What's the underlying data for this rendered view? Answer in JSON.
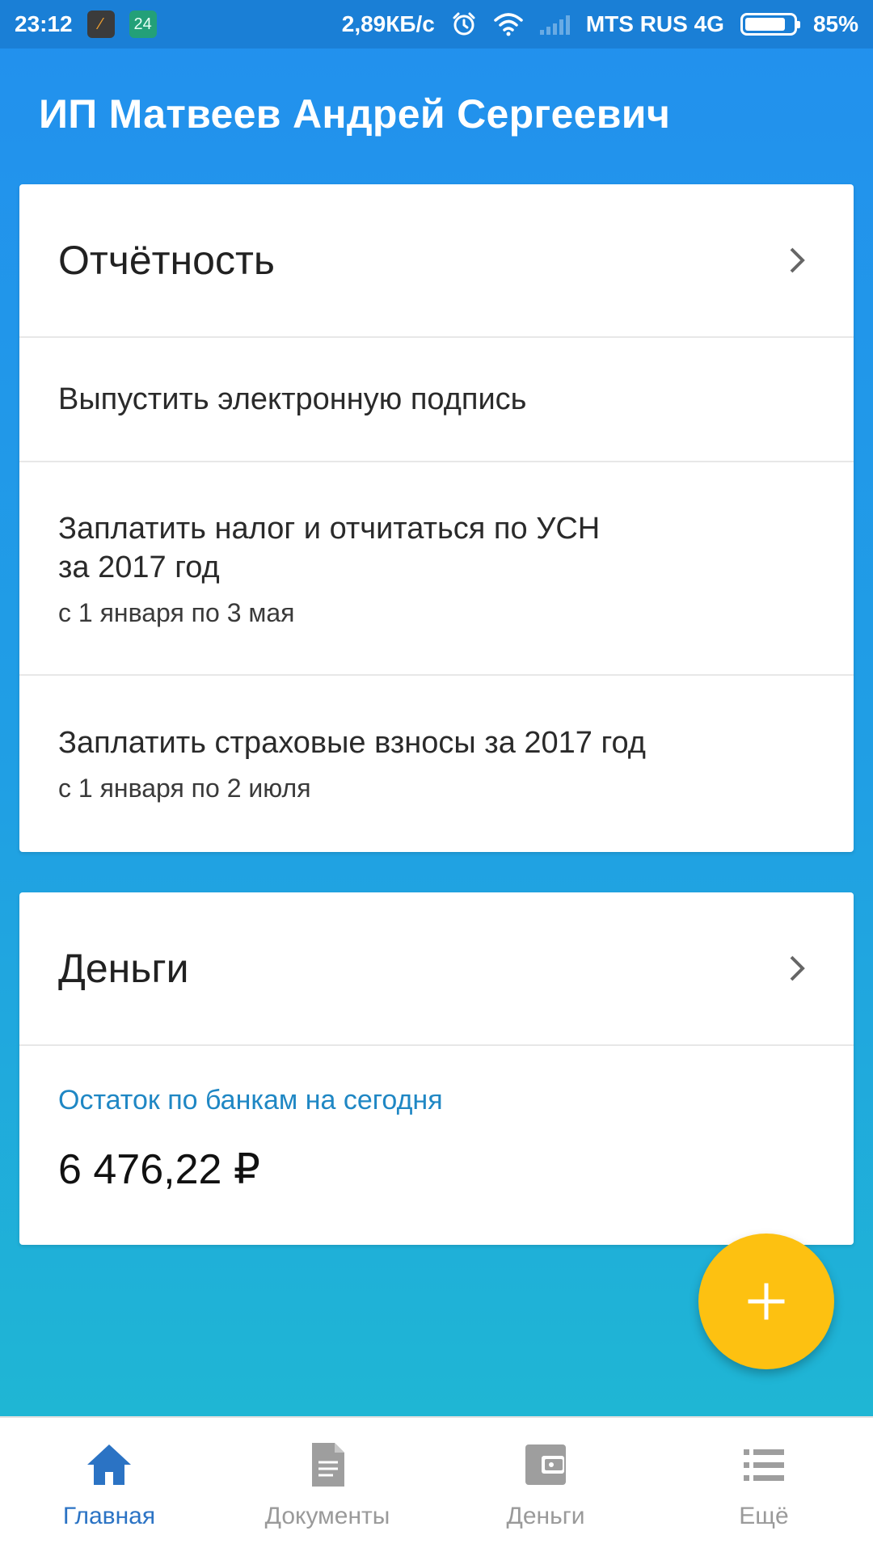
{
  "status_bar": {
    "time": "23:12",
    "notification_badge": "24",
    "net_speed": "2,89КБ/с",
    "carrier": "MTS RUS 4G",
    "battery": "85%",
    "battery_level": 0.85
  },
  "header": {
    "title": "ИП Матвеев Андрей Сергеевич"
  },
  "reports_card": {
    "title": "Отчётность",
    "items": [
      {
        "title": "Выпустить электронную подпись",
        "subtitle": ""
      },
      {
        "title": "Заплатить налог и отчитаться по УСН\nза 2017 год",
        "subtitle": "с 1 января по 3 мая"
      },
      {
        "title": "Заплатить страховые взносы за 2017 год",
        "subtitle": "с 1 января по 2 июля"
      }
    ]
  },
  "money_card": {
    "title": "Деньги",
    "balance_label": "Остаток по банкам на сегодня",
    "balance_value": "6 476,22 ₽"
  },
  "fab": {
    "icon": "plus-icon",
    "color": "#fdc111"
  },
  "bottom_nav": {
    "items": [
      {
        "label": "Главная",
        "icon": "home-icon",
        "active": true
      },
      {
        "label": "Документы",
        "icon": "document-icon",
        "active": false
      },
      {
        "label": "Деньги",
        "icon": "wallet-icon",
        "active": false
      },
      {
        "label": "Ещё",
        "icon": "list-icon",
        "active": false
      }
    ]
  },
  "colors": {
    "primary": "#2196f3",
    "accent": "#fdc111",
    "active_nav": "#2b73c4",
    "link_text": "#1f87c4"
  }
}
